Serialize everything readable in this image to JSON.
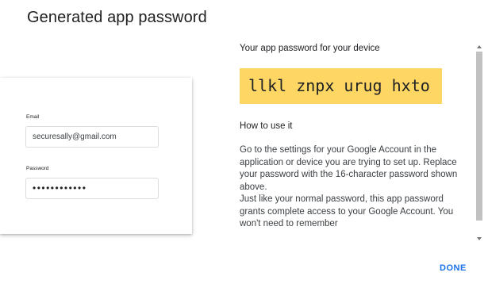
{
  "dialog": {
    "title": "Generated app password",
    "done_label": "DONE"
  },
  "login_card": {
    "email_label": "Email",
    "email_value": "securesally@gmail.com",
    "password_label": "Password",
    "password_masked": "••••••••••••"
  },
  "panel": {
    "heading": "Your app password for your device",
    "app_password": "llkl znpx urug hxto",
    "howto_heading": "How to use it",
    "instructions": "Go to the settings for your Google Account in the application or device you are trying to set up. Replace your password with the 16-character password shown above.\nJust like your normal password, this app password grants complete access to your Google Account. You won't need to remember"
  },
  "colors": {
    "password_highlight": "#fdd663",
    "accent": "#1a73e8"
  }
}
